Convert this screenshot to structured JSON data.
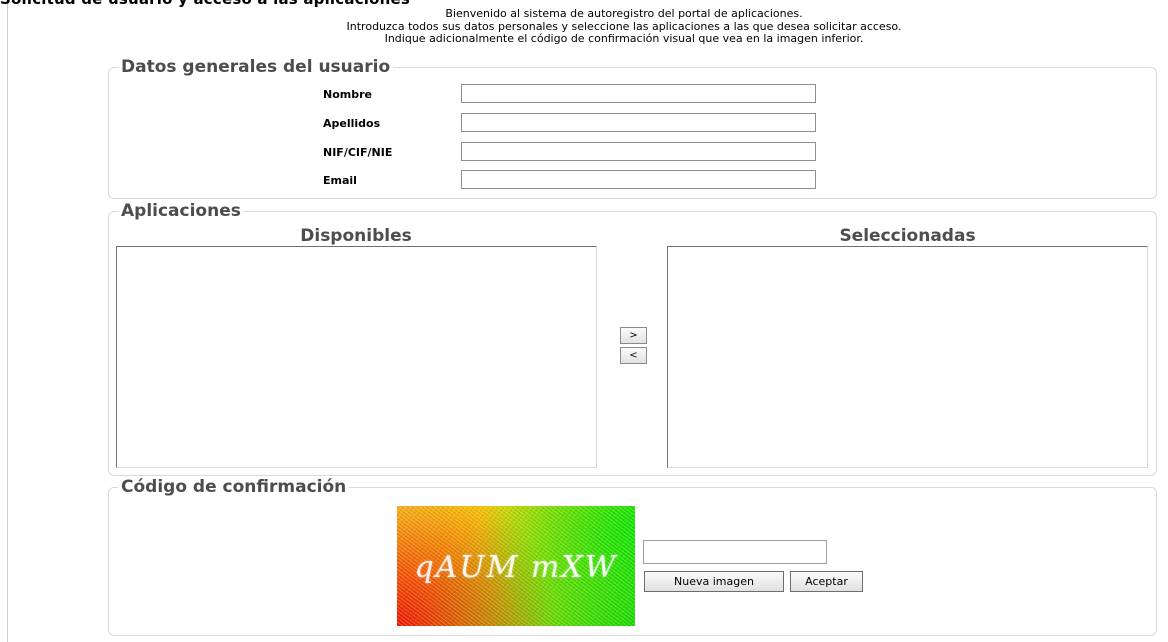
{
  "page": {
    "title": "Solicitud de usuario y acceso a las aplicaciones",
    "intro": [
      "Bienvenido al sistema de autoregistro del portal de aplicaciones.",
      "Introduzca todos sus datos personales y seleccione las aplicaciones a las que desea solicitar acceso.",
      "Indique adicionalmente el código de confirmación visual que vea en la imagen inferior."
    ]
  },
  "user_data": {
    "legend": "Datos generales del usuario",
    "fields": [
      {
        "label": "Nombre",
        "value": ""
      },
      {
        "label": "Apellidos",
        "value": ""
      },
      {
        "label": "NIF/CIF/NIE",
        "value": ""
      },
      {
        "label": "Email",
        "value": ""
      }
    ]
  },
  "applications": {
    "legend": "Aplicaciones",
    "available_title": "Disponibles",
    "selected_title": "Seleccionadas",
    "available_items": [],
    "selected_items": [],
    "add_label": ">",
    "remove_label": "<"
  },
  "confirmation": {
    "legend": "Código de confirmación",
    "captcha_text": "qAUM mXW",
    "code_value": "",
    "new_image_label": "Nueva imagen",
    "accept_label": "Aceptar"
  }
}
